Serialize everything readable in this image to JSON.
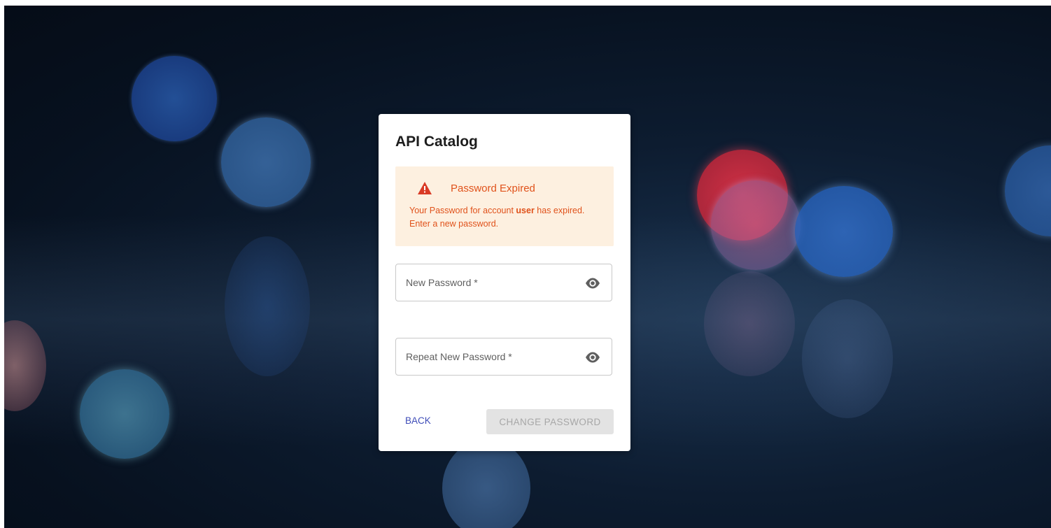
{
  "app": {
    "title": "API Catalog"
  },
  "alert": {
    "icon": "warning-triangle-icon",
    "title": "Password Expired",
    "message_before": "Your Password for account ",
    "account": "user",
    "message_after": " has expired. Enter a new password.",
    "color": "#e0521b",
    "background": "#fdf0e0"
  },
  "form": {
    "new_password": {
      "label": "New Password *",
      "value": "",
      "icon": "eye-icon"
    },
    "repeat_password": {
      "label": "Repeat New Password *",
      "value": "",
      "icon": "eye-icon"
    }
  },
  "actions": {
    "back_label": "BACK",
    "change_label": "CHANGE PASSWORD",
    "change_disabled": true,
    "accent": "#3f4db8"
  }
}
